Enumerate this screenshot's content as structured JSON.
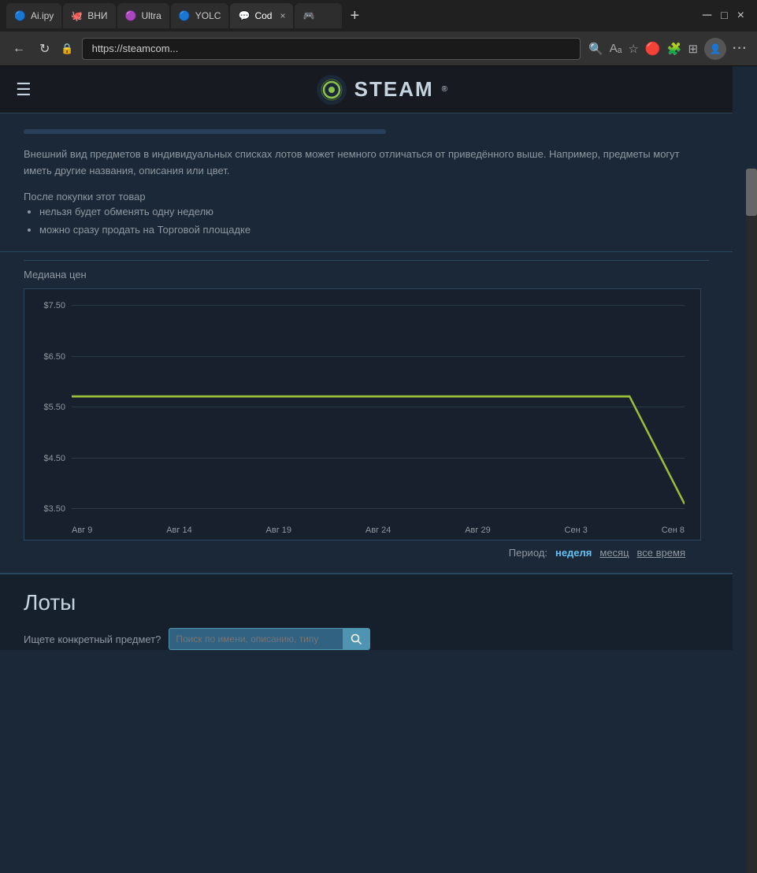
{
  "browser": {
    "tabs": [
      {
        "id": "ai",
        "label": "Ai.ipy",
        "icon": "🔵",
        "active": false
      },
      {
        "id": "vni",
        "label": "ВНИ",
        "icon": "🐙",
        "active": false
      },
      {
        "id": "ultra",
        "label": "Ultra",
        "icon": "🟣",
        "active": false
      },
      {
        "id": "yolc",
        "label": "YOLC",
        "icon": "🔵",
        "active": false
      },
      {
        "id": "cod",
        "label": "Cod",
        "icon": "💬",
        "active": true
      },
      {
        "id": "steam",
        "label": "",
        "icon": "🎮",
        "active": false
      }
    ],
    "address": "https://steamcom...",
    "close_label": "×",
    "add_label": "+"
  },
  "steam": {
    "header": {
      "menu_label": "☰",
      "logo_text": "STEAM",
      "registered": "®"
    },
    "info": {
      "appearance_text": "Внешний вид предметов в индивидуальных списках лотов может немного отличаться от приведённого выше. Например, предметы могут иметь другие названия, описания или цвет.",
      "purchase_title": "После покупки этот товар",
      "rules": [
        "нельзя будет обменять одну неделю",
        "можно сразу продать на Торговой площадке"
      ]
    },
    "chart": {
      "title": "Медиана цен",
      "y_labels": [
        "$7.50",
        "$6.50",
        "$5.50",
        "$4.50",
        "$3.50"
      ],
      "x_labels": [
        "Авг 9",
        "Авг 14",
        "Авг 19",
        "Авг 24",
        "Авг 29",
        "Сен 3",
        "Сен 8"
      ],
      "period_label": "Период:",
      "periods": [
        {
          "label": "неделя",
          "active": true
        },
        {
          "label": "месяц",
          "active": false
        },
        {
          "label": "все время",
          "active": false
        }
      ]
    },
    "lots": {
      "title": "Лоты",
      "search_label": "Ищете конкретный предмет?",
      "search_placeholder": "Поиск по имени, описанию, типу"
    }
  }
}
